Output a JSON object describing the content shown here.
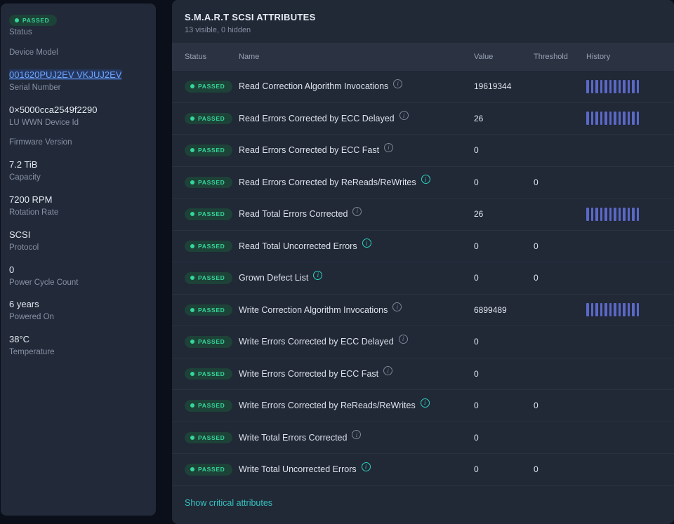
{
  "colors": {
    "page_background": "#0b0f1a",
    "card_background": "#212836",
    "table_header_background": "#2b3343",
    "badge_green": "#35d69b",
    "history_bar_indigo": "#5a68c7",
    "critical_icon_teal": "#2bd4c0",
    "link_teal": "#35c3c0",
    "serial_highlight_blue": "#6ea6fb"
  },
  "sidebar": {
    "fields": [
      {
        "badge": "PASSED",
        "value": "",
        "label": "Status"
      },
      {
        "value": "",
        "label": "Device Model"
      },
      {
        "value": "001620PUJ2EV VKJUJ2EV",
        "label": "Serial Number",
        "highlighted": true
      },
      {
        "value": "0×5000cca2549f2290",
        "label": "LU WWN Device Id"
      },
      {
        "value": "",
        "label": "Firmware Version"
      },
      {
        "value": "7.2 TiB",
        "label": "Capacity"
      },
      {
        "value": "7200 RPM",
        "label": "Rotation Rate"
      },
      {
        "value": "SCSI",
        "label": "Protocol"
      },
      {
        "value": "0",
        "label": "Power Cycle Count"
      },
      {
        "value": "6 years",
        "label": "Powered On"
      },
      {
        "value": "38°C",
        "label": "Temperature"
      }
    ]
  },
  "main": {
    "title": "S.M.A.R.T SCSI ATTRIBUTES",
    "subtitle": "13 visible, 0 hidden",
    "footer_link": "Show critical attributes",
    "sparkline_bar_count": 12,
    "table": {
      "headers": [
        "Status",
        "Name",
        "Value",
        "Threshold",
        "History"
      ],
      "rows": [
        {
          "status": "PASSED",
          "name": "Read Correction Algorithm Invocations",
          "value": "19619344",
          "threshold": "",
          "history": true,
          "critical": false
        },
        {
          "status": "PASSED",
          "name": "Read Errors Corrected by ECC Delayed",
          "value": "26",
          "threshold": "",
          "history": true,
          "critical": false
        },
        {
          "status": "PASSED",
          "name": "Read Errors Corrected by ECC Fast",
          "value": "0",
          "threshold": "",
          "history": false,
          "critical": false
        },
        {
          "status": "PASSED",
          "name": "Read Errors Corrected by ReReads/ReWrites",
          "value": "0",
          "threshold": "0",
          "history": false,
          "critical": true
        },
        {
          "status": "PASSED",
          "name": "Read Total Errors Corrected",
          "value": "26",
          "threshold": "",
          "history": true,
          "critical": false
        },
        {
          "status": "PASSED",
          "name": "Read Total Uncorrected Errors",
          "value": "0",
          "threshold": "0",
          "history": false,
          "critical": true
        },
        {
          "status": "PASSED",
          "name": "Grown Defect List",
          "value": "0",
          "threshold": "0",
          "history": false,
          "critical": true
        },
        {
          "status": "PASSED",
          "name": "Write Correction Algorithm Invocations",
          "value": "6899489",
          "threshold": "",
          "history": true,
          "critical": false
        },
        {
          "status": "PASSED",
          "name": "Write Errors Corrected by ECC Delayed",
          "value": "0",
          "threshold": "",
          "history": false,
          "critical": false
        },
        {
          "status": "PASSED",
          "name": "Write Errors Corrected by ECC Fast",
          "value": "0",
          "threshold": "",
          "history": false,
          "critical": false
        },
        {
          "status": "PASSED",
          "name": "Write Errors Corrected by ReReads/ReWrites",
          "value": "0",
          "threshold": "0",
          "history": false,
          "critical": true
        },
        {
          "status": "PASSED",
          "name": "Write Total Errors Corrected",
          "value": "0",
          "threshold": "",
          "history": false,
          "critical": false
        },
        {
          "status": "PASSED",
          "name": "Write Total Uncorrected Errors",
          "value": "0",
          "threshold": "0",
          "history": false,
          "critical": true
        }
      ]
    }
  }
}
